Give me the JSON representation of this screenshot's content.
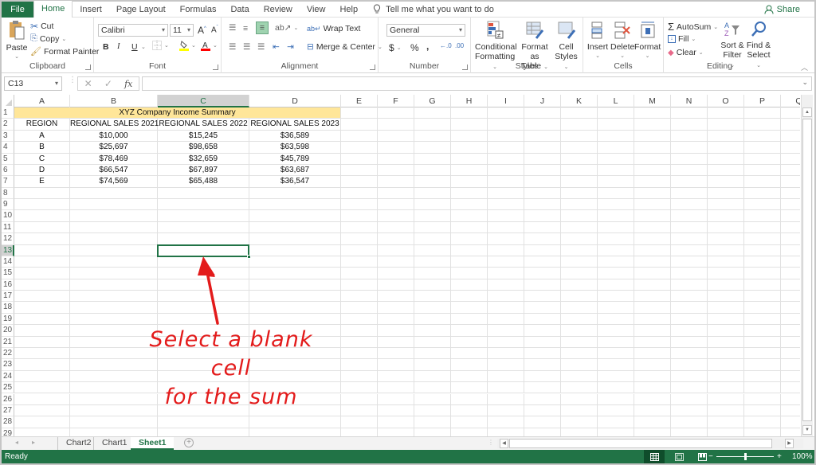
{
  "menu": {
    "tabs": [
      "File",
      "Home",
      "Insert",
      "Page Layout",
      "Formulas",
      "Data",
      "Review",
      "View",
      "Help"
    ],
    "active_tab": "Home",
    "tell_me": "Tell me what you want to do",
    "share": "Share"
  },
  "ribbon": {
    "clipboard": {
      "label": "Clipboard",
      "paste": "Paste",
      "cut": "Cut",
      "copy": "Copy",
      "format_painter": "Format Painter"
    },
    "font": {
      "label": "Font",
      "font_name": "Calibri",
      "font_size": "11",
      "bold": "B",
      "italic": "I",
      "underline": "U",
      "colors": {
        "highlight": "#ffff00",
        "font_color": "#ff0000"
      }
    },
    "alignment": {
      "label": "Alignment",
      "wrap_text": "Wrap Text",
      "merge_center": "Merge & Center"
    },
    "number": {
      "label": "Number",
      "format": "General",
      "currency": "$",
      "percent": "%",
      "comma": ","
    },
    "styles": {
      "label": "Styles",
      "conditional_1": "Conditional",
      "conditional_2": "Formatting",
      "format_table_1": "Format as",
      "format_table_2": "Table",
      "cell_styles_1": "Cell",
      "cell_styles_2": "Styles"
    },
    "cells": {
      "label": "Cells",
      "insert": "Insert",
      "delete": "Delete",
      "format": "Format"
    },
    "editing": {
      "label": "Editing",
      "autosum": "AutoSum",
      "fill": "Fill",
      "clear": "Clear",
      "sort_1": "Sort &",
      "sort_2": "Filter",
      "find_1": "Find &",
      "find_2": "Select"
    }
  },
  "formula_bar": {
    "name_box": "C13",
    "fx": "fx",
    "formula": ""
  },
  "sheet": {
    "columns": [
      "A",
      "B",
      "C",
      "D",
      "E",
      "F",
      "G",
      "H",
      "I",
      "J",
      "K",
      "L",
      "M",
      "N",
      "O",
      "P",
      "Q"
    ],
    "selected_column": "C",
    "selected_row": 13,
    "selected_cell": "C13",
    "row_count": 29,
    "title": "XYZ Company Income Summary",
    "title_fill": "#ffe699",
    "headers": [
      "REGION",
      "REGIONAL SALES 2021",
      "REGIONAL SALES 2022",
      "REGIONAL SALES 2023"
    ],
    "rows": [
      [
        "A",
        "$10,000",
        "$15,245",
        "$36,589"
      ],
      [
        "B",
        "$25,697",
        "$98,658",
        "$63,598"
      ],
      [
        "C",
        "$78,469",
        "$32,659",
        "$45,789"
      ],
      [
        "D",
        "$66,547",
        "$67,897",
        "$63,687"
      ],
      [
        "E",
        "$74,569",
        "$65,488",
        "$36,547"
      ]
    ]
  },
  "annotation": {
    "line1": "Select a blank cell",
    "line2": "for the sum",
    "color": "#e31b1b"
  },
  "sheet_tabs": {
    "tabs": [
      "Chart2",
      "Chart1",
      "Sheet1"
    ],
    "active": "Sheet1"
  },
  "status": {
    "text": "Ready",
    "zoom": "100%",
    "zoom_minus": "−",
    "zoom_plus": "+"
  },
  "theme": {
    "accent": "#217346"
  }
}
